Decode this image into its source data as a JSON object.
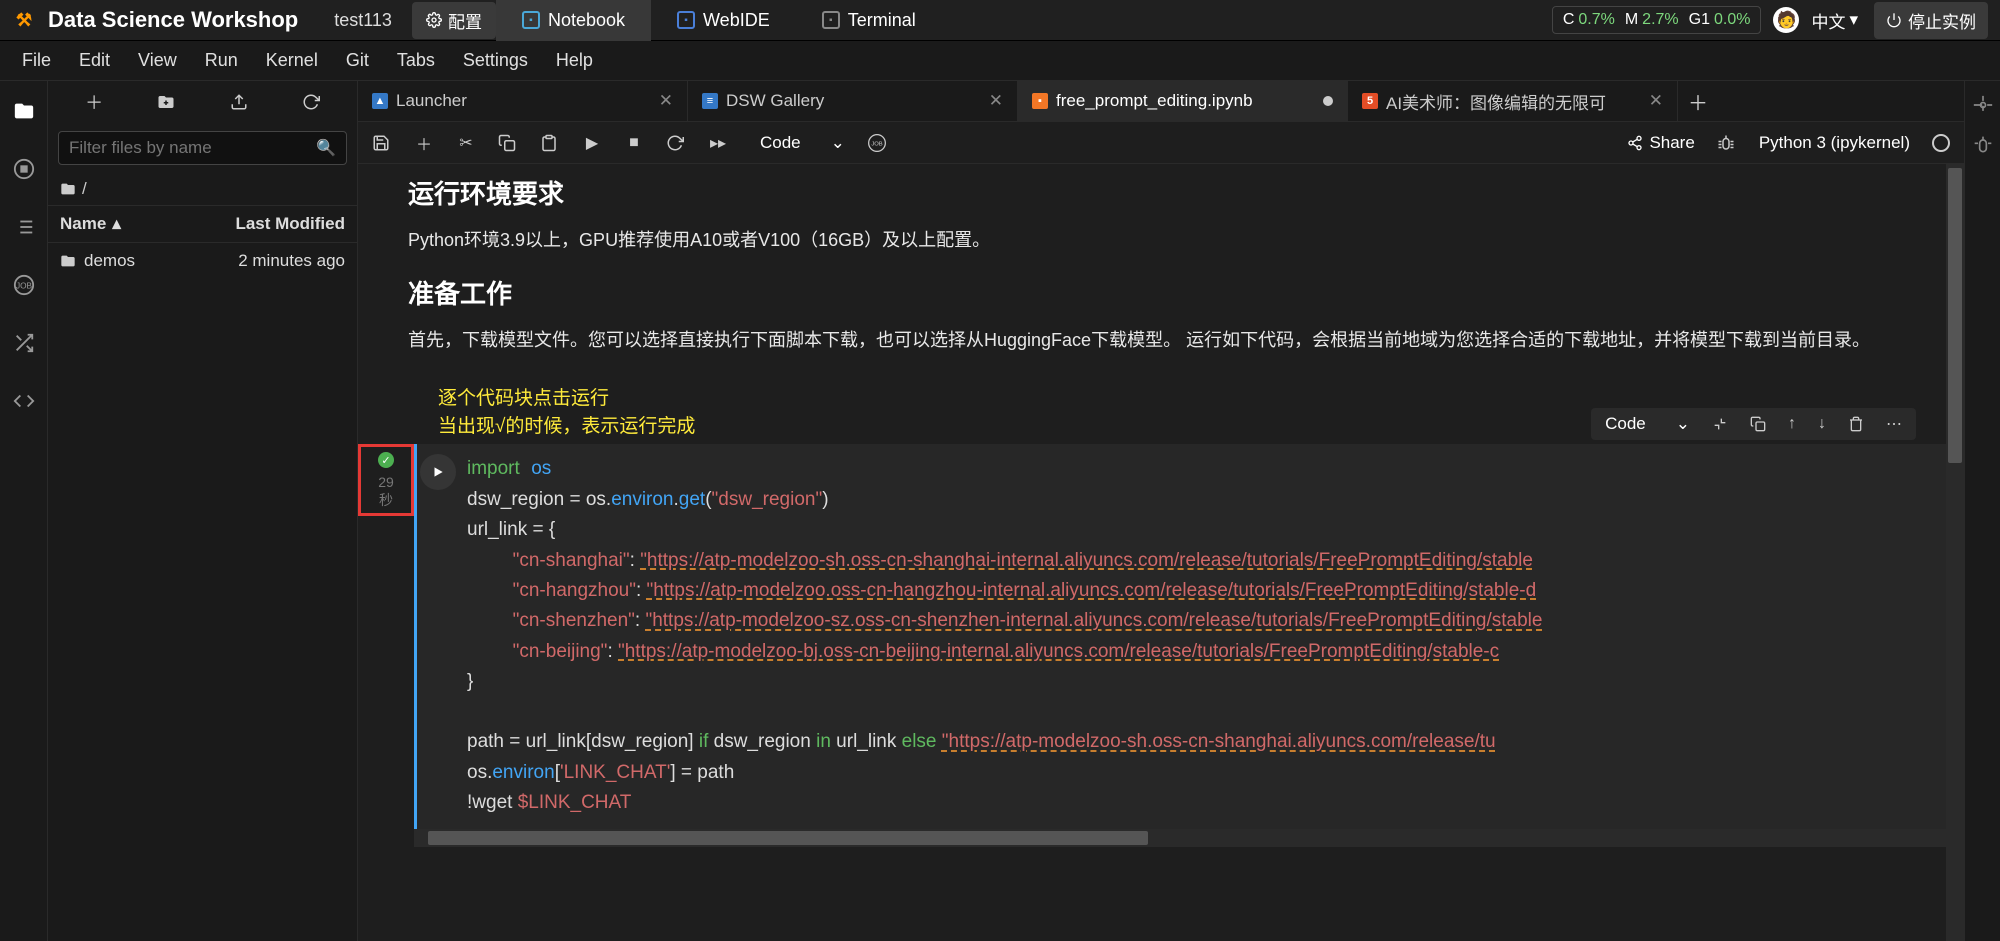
{
  "topbar": {
    "brand": "Data Science Workshop",
    "instance": "test113",
    "config_label": "配置",
    "tabs": {
      "notebook": "Notebook",
      "webide": "WebIDE",
      "terminal": "Terminal"
    },
    "stats": {
      "c_lbl": "C",
      "c_val": "0.7%",
      "m_lbl": "M",
      "m_val": "2.7%",
      "g_lbl": "G1",
      "g_val": "0.0%"
    },
    "lang": "中文",
    "stop": "停止实例"
  },
  "menubar": {
    "file": "File",
    "edit": "Edit",
    "view": "View",
    "run": "Run",
    "kernel": "Kernel",
    "git": "Git",
    "tabs": "Tabs",
    "settings": "Settings",
    "help": "Help"
  },
  "sidebar": {
    "filter_placeholder": "Filter files by name",
    "crumb": "/",
    "headers": {
      "name": "Name",
      "modified": "Last Modified"
    },
    "rows": [
      {
        "name": "demos",
        "modified": "2 minutes ago"
      }
    ]
  },
  "tabs": [
    {
      "label": "Launcher",
      "active": false,
      "closable": true,
      "icon": "launcher"
    },
    {
      "label": "DSW Gallery",
      "active": false,
      "closable": true,
      "icon": "gallery"
    },
    {
      "label": "free_prompt_editing.ipynb",
      "active": true,
      "closable": false,
      "dirty": true,
      "icon": "nb"
    },
    {
      "label": "AI美术师：图像编辑的无限可",
      "active": false,
      "closable": true,
      "icon": "html"
    }
  ],
  "nbtool": {
    "celltype": "Code",
    "share": "Share",
    "kernel": "Python 3 (ipykernel)"
  },
  "celltoolbar": {
    "type": "Code"
  },
  "markdown": {
    "h1": "运行环境要求",
    "p1": "Python环境3.9以上，GPU推荐使用A10或者V100（16GB）及以上配置。",
    "h2": "准备工作",
    "p2": "首先，下载模型文件。您可以选择直接执行下面脚本下载，也可以选择从HuggingFace下载模型。 运行如下代码，会根据当前地域为您选择合适的下载地址，并将模型下载到当前目录。"
  },
  "annotation": {
    "l1": "逐个代码块点击运行",
    "l2": "当出现√的时候，表示运行完成"
  },
  "cell": {
    "exec_time": "29",
    "exec_unit": "秒",
    "code": {
      "l1_kw": "import",
      "l1_mod": "os",
      "l2_a": "dsw_region ",
      "l2_b": "=",
      "l2_c": " os.",
      "l2_d": "environ",
      "l2_e": ".",
      "l2_f": "get",
      "l2_g": "(",
      "l2_h": "\"dsw_region\"",
      "l2_i": ")",
      "l3": "url_link = {",
      "l4_k": "\"cn-shanghai\"",
      "l4_c": ": ",
      "l4_v": "\"https://atp-modelzoo-sh.oss-cn-shanghai-internal.aliyuncs.com/release/tutorials/FreePromptEditing/stable",
      "l5_k": "\"cn-hangzhou\"",
      "l5_c": ": ",
      "l5_v": "\"https://atp-modelzoo.oss-cn-hangzhou-internal.aliyuncs.com/release/tutorials/FreePromptEditing/stable-d",
      "l6_k": "\"cn-shenzhen\"",
      "l6_c": ": ",
      "l6_v": "\"https://atp-modelzoo-sz.oss-cn-shenzhen-internal.aliyuncs.com/release/tutorials/FreePromptEditing/stable",
      "l7_k": "\"cn-beijing\"",
      "l7_c": ": ",
      "l7_v": "\"https://atp-modelzoo-bj.oss-cn-beijing-internal.aliyuncs.com/release/tutorials/FreePromptEditing/stable-c",
      "l8": "}",
      "l10_a": "path ",
      "l10_b": "=",
      "l10_c": " url_link[dsw_region] ",
      "l10_d": "if",
      "l10_e": " dsw_region ",
      "l10_f": "in",
      "l10_g": " url_link ",
      "l10_h": "else",
      "l10_i": " ",
      "l10_j": "\"https://atp-modelzoo-sh.oss-cn-shanghai.aliyuncs.com/release/tu",
      "l11_a": "os.",
      "l11_b": "environ",
      "l11_c": "[",
      "l11_d": "'LINK_CHAT'",
      "l11_e": "] ",
      "l11_f": "=",
      "l11_g": " path",
      "l12_a": "!wget ",
      "l12_b": "$LINK_CHAT"
    }
  }
}
